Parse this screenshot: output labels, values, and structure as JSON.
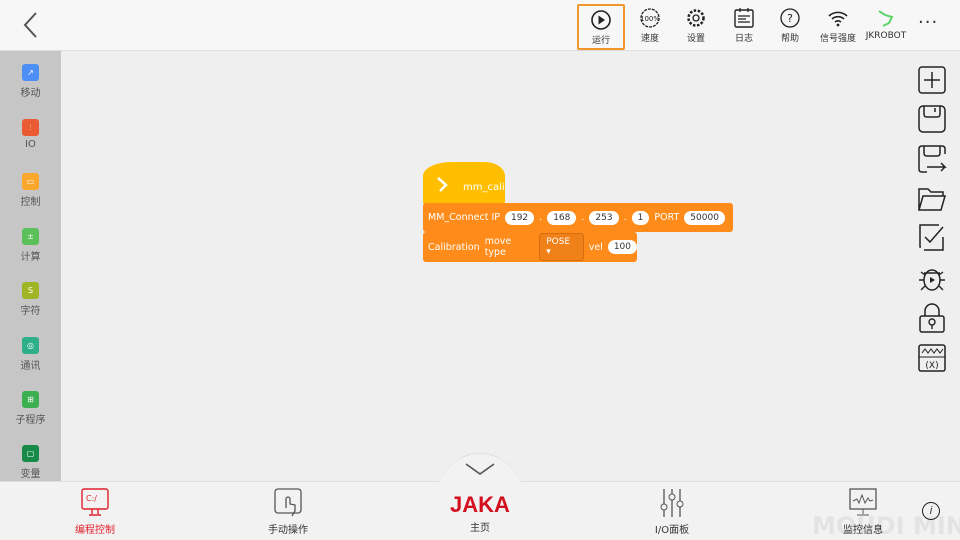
{
  "toolbar": {
    "items": [
      {
        "label": "运行",
        "icon": "play-icon"
      },
      {
        "label": "速度",
        "icon": "speed-icon",
        "badge": "100%"
      },
      {
        "label": "设置",
        "icon": "gear-icon"
      },
      {
        "label": "日志",
        "icon": "log-icon"
      },
      {
        "label": "帮助",
        "icon": "help-icon",
        "glyph": "?"
      },
      {
        "label": "信号强度",
        "icon": "wifi-icon"
      },
      {
        "label": "JKROBOT",
        "icon": "robot-arm-icon"
      }
    ],
    "more": "···"
  },
  "sidebar": {
    "items": [
      {
        "label": "移动",
        "color": "#4d8ff5"
      },
      {
        "label": "IO",
        "color": "#ea5a33"
      },
      {
        "label": "控制",
        "color": "#fba62c"
      },
      {
        "label": "计算",
        "color": "#5cc05a"
      },
      {
        "label": "字符",
        "color": "#a0b525"
      },
      {
        "label": "通讯",
        "color": "#2fae8a"
      },
      {
        "label": "子程序",
        "color": "#3cb050"
      },
      {
        "label": "变量",
        "color": "#178a48"
      }
    ]
  },
  "blocks": {
    "hat": {
      "label": "mm_cali",
      "color": "#ffbf00"
    },
    "connect": {
      "label": "MM_Connect IP",
      "ip": [
        "192",
        "168",
        "253",
        "1"
      ],
      "dot": ".",
      "port_label": "PORT",
      "port": "50000",
      "color": "#ff8c1a"
    },
    "calib": {
      "label": "Calibration",
      "move_type_label": "move type",
      "move_type": "POSE",
      "vel_label": "vel",
      "vel": "100"
    }
  },
  "bottom": {
    "items": [
      {
        "label": "编程控制",
        "active": true,
        "screen_text": "C:/"
      },
      {
        "label": "手动操作"
      },
      {
        "label": "主页",
        "logo": "JAKA"
      },
      {
        "label": "I/O面板"
      },
      {
        "label": "监控信息"
      }
    ],
    "info": "i",
    "watermark": "MOUDI MIND"
  },
  "colors": {
    "accent": "#e0202e",
    "active_border": "#f0962a"
  }
}
